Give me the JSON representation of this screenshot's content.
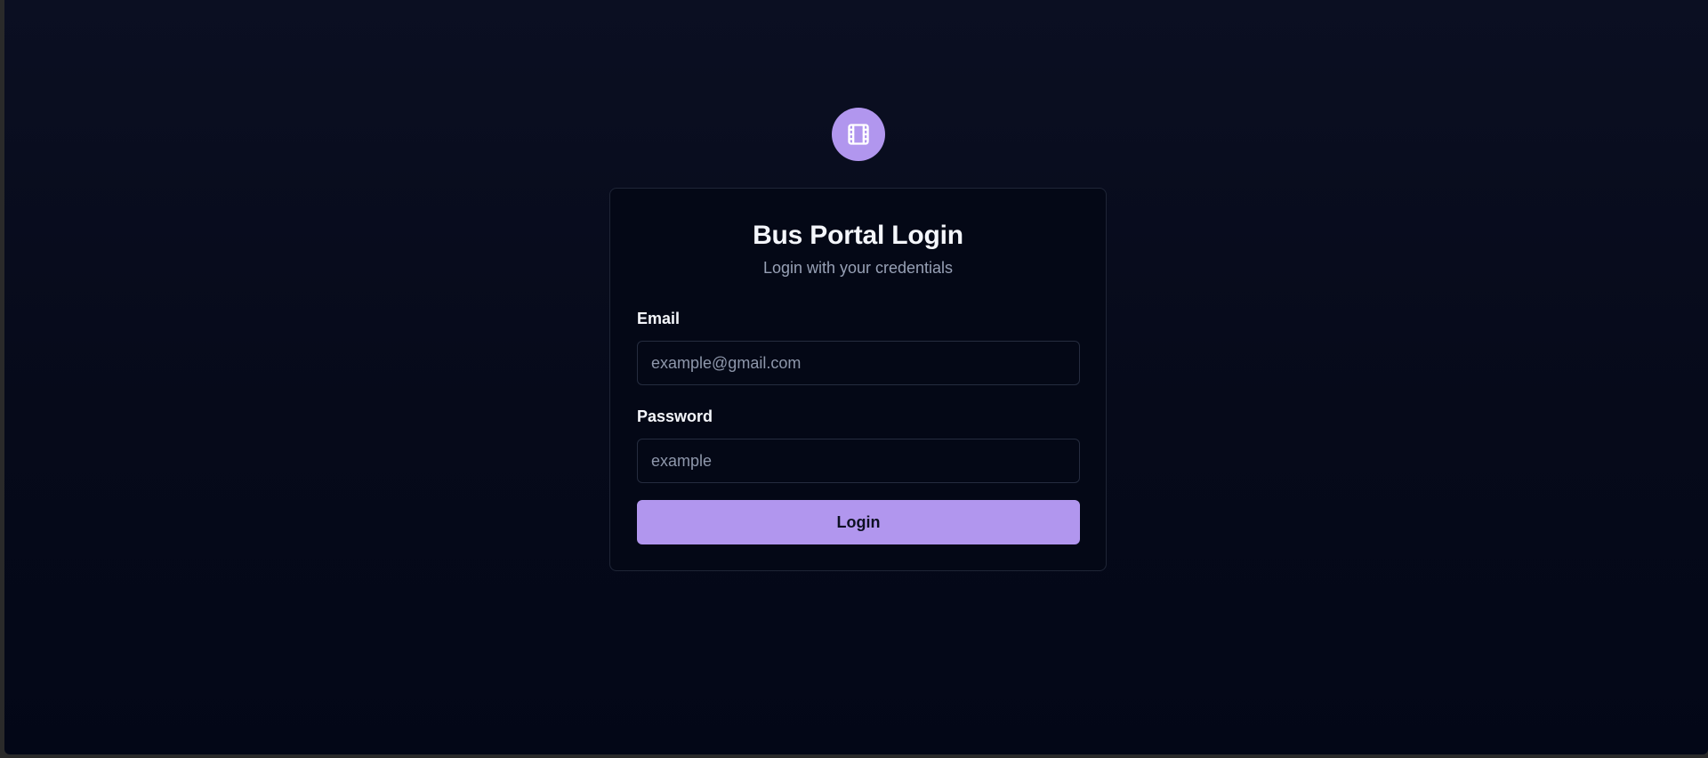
{
  "brand": {
    "icon": "film-icon",
    "badge_color": "#b196ee"
  },
  "login": {
    "title": "Bus Portal Login",
    "subtitle": "Login with your credentials",
    "email_label": "Email",
    "email_placeholder": "example@gmail.com",
    "email_value": "",
    "password_label": "Password",
    "password_placeholder": "example",
    "password_value": "",
    "submit_label": "Login"
  },
  "colors": {
    "accent": "#b196ee",
    "background": "#070b1c",
    "card": "#040816",
    "text_primary": "#f4f6fb",
    "text_muted": "#97a0b5"
  }
}
